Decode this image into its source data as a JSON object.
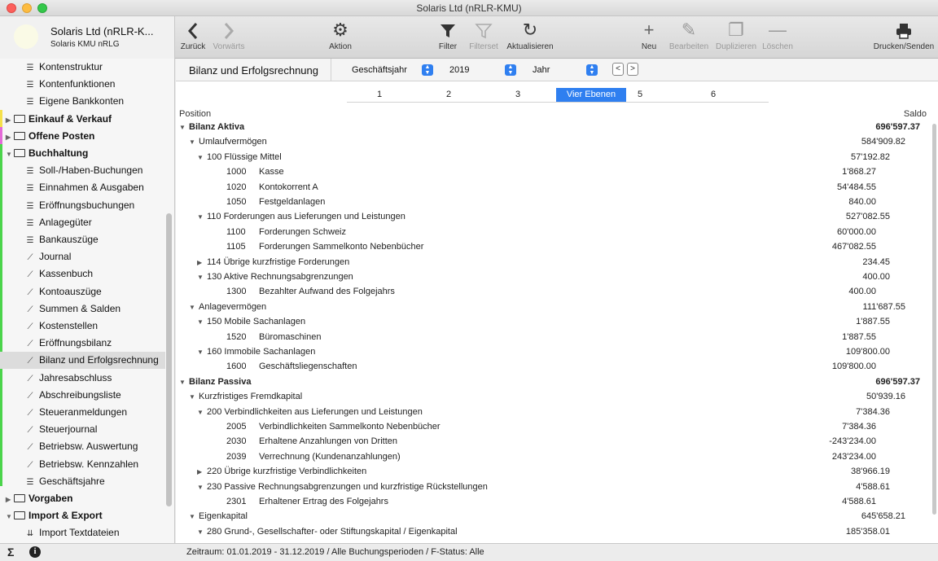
{
  "window": {
    "title": "Solaris Ltd  (nRLR-KMU)"
  },
  "company": {
    "name": "Solaris Ltd  (nRLR-K...",
    "subtitle": "Solaris KMU nRLG"
  },
  "toolbar": {
    "back": "Zurück",
    "forward": "Vorwärts",
    "action": "Aktion",
    "filter": "Filter",
    "filterset": "Filterset",
    "refresh": "Aktualisieren",
    "new": "Neu",
    "edit": "Bearbeiten",
    "duplicate": "Duplizieren",
    "delete": "Löschen",
    "print": "Drucken/Senden"
  },
  "sidebar": {
    "items": [
      {
        "label": "Kontenstruktur",
        "kind": "child",
        "icon": "list-icon"
      },
      {
        "label": "Kontenfunktionen",
        "kind": "child",
        "icon": "list-icon"
      },
      {
        "label": "Eigene Bankkonten",
        "kind": "child",
        "icon": "list-icon"
      },
      {
        "label": "Einkauf & Verkauf",
        "kind": "group"
      },
      {
        "label": "Offene Posten",
        "kind": "group"
      },
      {
        "label": "Buchhaltung",
        "kind": "group",
        "expanded": true
      },
      {
        "label": "Soll-/Haben-Buchungen",
        "kind": "child",
        "icon": "list-icon"
      },
      {
        "label": "Einnahmen & Ausgaben",
        "kind": "child",
        "icon": "list-icon"
      },
      {
        "label": "Eröffnungsbuchungen",
        "kind": "child",
        "icon": "list-icon"
      },
      {
        "label": "Anlagegüter",
        "kind": "child",
        "icon": "list-icon"
      },
      {
        "label": "Bankauszüge",
        "kind": "child",
        "icon": "list-icon"
      },
      {
        "label": "Journal",
        "kind": "child",
        "icon": "chart-icon"
      },
      {
        "label": "Kassenbuch",
        "kind": "child",
        "icon": "chart-icon"
      },
      {
        "label": "Kontoauszüge",
        "kind": "child",
        "icon": "chart-icon"
      },
      {
        "label": "Summen & Salden",
        "kind": "child",
        "icon": "chart-icon"
      },
      {
        "label": "Kostenstellen",
        "kind": "child",
        "icon": "chart-icon"
      },
      {
        "label": "Eröffnungsbilanz",
        "kind": "child",
        "icon": "chart-icon"
      },
      {
        "label": "Bilanz und Erfolgsrechnung",
        "kind": "child",
        "icon": "chart-icon",
        "selected": true
      },
      {
        "label": "Jahresabschluss",
        "kind": "child",
        "icon": "chart-icon"
      },
      {
        "label": "Abschreibungsliste",
        "kind": "child",
        "icon": "chart-icon"
      },
      {
        "label": "Steueranmeldungen",
        "kind": "child",
        "icon": "chart-icon"
      },
      {
        "label": "Steuerjournal",
        "kind": "child",
        "icon": "chart-icon"
      },
      {
        "label": "Betriebsw. Auswertung",
        "kind": "child",
        "icon": "chart-icon"
      },
      {
        "label": "Betriebsw. Kennzahlen",
        "kind": "child",
        "icon": "chart-icon"
      },
      {
        "label": "Geschäftsjahre",
        "kind": "child",
        "icon": "list-icon"
      },
      {
        "label": "Vorgaben",
        "kind": "group"
      },
      {
        "label": "Import & Export",
        "kind": "group",
        "expanded": true
      },
      {
        "label": "Import Textdateien",
        "kind": "child",
        "icon": "import-icon"
      }
    ]
  },
  "report": {
    "title": "Bilanz und Erfolgsrechnung",
    "period_type": "Geschäftsjahr",
    "year": "2019",
    "interval": "Jahr",
    "levels": [
      "1",
      "2",
      "3",
      "Vier Ebenen",
      "5",
      "6"
    ],
    "active_level": "Vier Ebenen",
    "col_position": "Position",
    "col_saldo": "Saldo",
    "rows": [
      {
        "depth": 0,
        "tri": "▼",
        "label": "Bilanz Aktiva",
        "value": "696'597.37",
        "col": 0,
        "bold": true
      },
      {
        "depth": 1,
        "tri": "▼",
        "label": "Umlaufvermögen",
        "value": "584'909.82",
        "col": 1
      },
      {
        "depth": 2,
        "tri": "▼",
        "label": "100 Flüssige Mittel",
        "value": "57'192.82",
        "col": 2
      },
      {
        "depth": 3,
        "account": "1000",
        "label": "Kasse",
        "value": "1'868.27",
        "col": 3
      },
      {
        "depth": 3,
        "account": "1020",
        "label": "Kontokorrent A",
        "value": "54'484.55",
        "col": 3
      },
      {
        "depth": 3,
        "account": "1050",
        "label": "Festgeldanlagen",
        "value": "840.00",
        "col": 3
      },
      {
        "depth": 2,
        "tri": "▼",
        "label": "110 Forderungen aus Lieferungen und Leistungen",
        "value": "527'082.55",
        "col": 2
      },
      {
        "depth": 3,
        "account": "1100",
        "label": "Forderungen Schweiz",
        "value": "60'000.00",
        "col": 3
      },
      {
        "depth": 3,
        "account": "1105",
        "label": "Forderungen Sammelkonto Nebenbücher",
        "value": "467'082.55",
        "col": 3
      },
      {
        "depth": 2,
        "tri": "▶",
        "label": "114 Übrige kurzfristige Forderungen",
        "value": "234.45",
        "col": 2
      },
      {
        "depth": 2,
        "tri": "▼",
        "label": "130 Aktive Rechnungsabgrenzungen",
        "value": "400.00",
        "col": 2
      },
      {
        "depth": 3,
        "account": "1300",
        "label": "Bezahlter Aufwand des Folgejahrs",
        "value": "400.00",
        "col": 3
      },
      {
        "depth": 1,
        "tri": "▼",
        "label": "Anlagevermögen",
        "value": "111'687.55",
        "col": 1
      },
      {
        "depth": 2,
        "tri": "▼",
        "label": "150 Mobile Sachanlagen",
        "value": "1'887.55",
        "col": 2
      },
      {
        "depth": 3,
        "account": "1520",
        "label": "Büromaschinen",
        "value": "1'887.55",
        "col": 3
      },
      {
        "depth": 2,
        "tri": "▼",
        "label": "160 Immobile Sachanlagen",
        "value": "109'800.00",
        "col": 2
      },
      {
        "depth": 3,
        "account": "1600",
        "label": "Geschäftsliegenschaften",
        "value": "109'800.00",
        "col": 3
      },
      {
        "depth": 0,
        "tri": "▼",
        "label": "Bilanz Passiva",
        "value": "696'597.37",
        "col": 0,
        "bold": true
      },
      {
        "depth": 1,
        "tri": "▼",
        "label": "Kurzfristiges Fremdkapital",
        "value": "50'939.16",
        "col": 1
      },
      {
        "depth": 2,
        "tri": "▼",
        "label": "200 Verbindlichkeiten aus Lieferungen und Leistungen",
        "value": "7'384.36",
        "col": 2
      },
      {
        "depth": 3,
        "account": "2005",
        "label": "Verbindlichkeiten Sammelkonto Nebenbücher",
        "value": "7'384.36",
        "col": 3
      },
      {
        "depth": 3,
        "account": "2030",
        "label": "Erhaltene Anzahlungen von Dritten",
        "value": "-243'234.00",
        "col": 3
      },
      {
        "depth": 3,
        "account": "2039",
        "label": "Verrechnung (Kundenanzahlungen)",
        "value": "243'234.00",
        "col": 3
      },
      {
        "depth": 2,
        "tri": "▶",
        "label": "220 Übrige kurzfristige Verbindlichkeiten",
        "value": "38'966.19",
        "col": 2
      },
      {
        "depth": 2,
        "tri": "▼",
        "label": "230 Passive Rechnungsabgrenzungen und kurzfristige Rückstellungen",
        "value": "4'588.61",
        "col": 2
      },
      {
        "depth": 3,
        "account": "2301",
        "label": "Erhaltener Ertrag des Folgejahrs",
        "value": "4'588.61",
        "col": 3
      },
      {
        "depth": 1,
        "tri": "▼",
        "label": "Eigenkapital",
        "value": "645'658.21",
        "col": 1
      },
      {
        "depth": 2,
        "tri": "▼",
        "label": "280 Grund-, Gesellschafter- oder Stiftungskapital / Eigenkapital",
        "value": "185'358.01",
        "col": 2
      }
    ]
  },
  "status": {
    "sigma": "Σ",
    "info": "i",
    "text": "Zeitraum: 01.01.2019 - 31.12.2019 / Alle Buchungsperioden / F-Status: Alle"
  },
  "colors": {
    "accent": "#2f7ff0",
    "bar_yellow": "#f5e04a",
    "bar_pink": "#e46ad8",
    "bar_green": "#4bd44b"
  }
}
